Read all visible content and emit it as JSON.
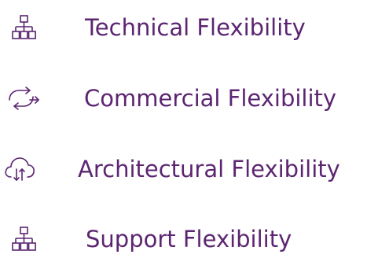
{
  "brand_color": "#5c2571",
  "items": [
    {
      "icon": "hierarchy-icon",
      "label": "Technical Flexibility"
    },
    {
      "icon": "exchange-arrows-icon",
      "label": "Commercial Flexibility"
    },
    {
      "icon": "cloud-transfer-icon",
      "label": "Architectural Flexibility"
    },
    {
      "icon": "hierarchy-icon",
      "label": "Support Flexibility"
    }
  ]
}
